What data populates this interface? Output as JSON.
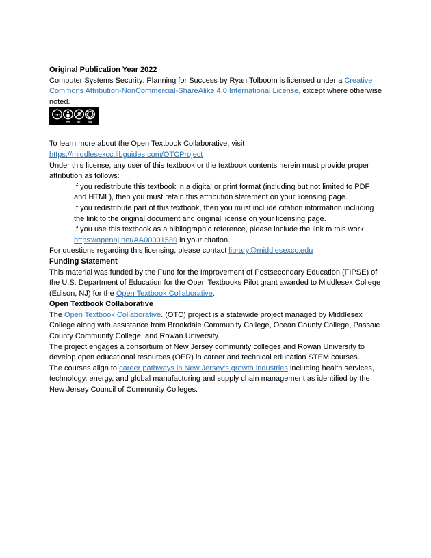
{
  "document": {
    "sections": [
      {
        "id": "publication-year",
        "type": "heading",
        "text": "Original Publication Year 2022"
      },
      {
        "id": "license-statement",
        "type": "paragraph",
        "prefix": "Computer Systems Security: Planning for Success by Ryan Tolboom is licensed under a ",
        "link_text": "Creative Commons Attribution-NonCommercial-ShareAlike 4.0 International License",
        "suffix": ", except where otherwise noted."
      },
      {
        "id": "cc-license-badge",
        "type": "image",
        "alt": "Creative Commons BY-NC-SA license badge",
        "icons": [
          "cc",
          "by",
          "nc",
          "sa"
        ],
        "labels": [
          "BY",
          "NC",
          "SA"
        ],
        "background": "#000000",
        "foreground": "#ffffff"
      },
      {
        "id": "learn-more",
        "type": "paragraph",
        "prefix": "To learn more about the Open Textbook Collaborative, visit ",
        "link_text": "https://middlesexcc.libguides.com/OTCProject",
        "suffix": ""
      },
      {
        "id": "attribution-intro",
        "type": "paragraph",
        "text": "Under this license, any user of this textbook or the textbook contents herein must provide proper attribution as follows:"
      },
      {
        "id": "attribution-item-1",
        "type": "indented",
        "text": "If you redistribute this textbook in a digital or print format (including but not limited to PDF and HTML), then you must retain this attribution statement on your licensing page."
      },
      {
        "id": "attribution-item-2",
        "type": "indented",
        "text": "If you redistribute part of this textbook, then you must include citation information including the link to the original document and original license on your licensing page."
      },
      {
        "id": "attribution-item-3",
        "type": "indented",
        "prefix": "If you use this textbook as a bibliographic reference, please include the link to this work ",
        "link_text": "https://opennj.net/AA00001539",
        "suffix": " in your citation."
      },
      {
        "id": "licensing-contact",
        "type": "paragraph",
        "prefix": "For questions regarding this licensing, please contact ",
        "link_text": "library@middlesexcc.edu",
        "suffix": ""
      },
      {
        "id": "funding-statement-heading",
        "type": "heading",
        "text": "Funding Statement"
      },
      {
        "id": "funding-statement-body",
        "type": "paragraph",
        "prefix": "This material was funded by the Fund for the Improvement of Postsecondary Education (FIPSE) of the U.S. Department of Education for the Open Textbooks Pilot grant awarded to Middlesex College (Edison, NJ) for the ",
        "link_text": "Open Textbook Collaborative",
        "suffix": "."
      },
      {
        "id": "otc-heading",
        "type": "heading",
        "text": "Open Textbook Collaborative"
      },
      {
        "id": "otc-description",
        "type": "paragraph",
        "prefix": "The ",
        "link_text": "Open Textbook Collaborative",
        "suffix": ". (OTC) project is a statewide project managed by Middlesex College along with assistance from Brookdale Community College, Ocean County College, Passaic County Community College, and Rowan University."
      },
      {
        "id": "otc-consortium",
        "type": "paragraph",
        "text": "The project engages a consortium of New Jersey community colleges and Rowan University to develop open educational resources (OER) in career and technical education STEM courses."
      },
      {
        "id": "otc-pathways",
        "type": "paragraph",
        "prefix": "The courses align to ",
        "link_text": "career pathways in New Jersey’s growth industries",
        "suffix": " including health services, technology, energy, and global manufacturing and supply chain management as identified by the New Jersey Council of Community Colleges."
      }
    ],
    "colors": {
      "text": "#000000",
      "link": "#2e74b5",
      "background": "#ffffff"
    }
  }
}
